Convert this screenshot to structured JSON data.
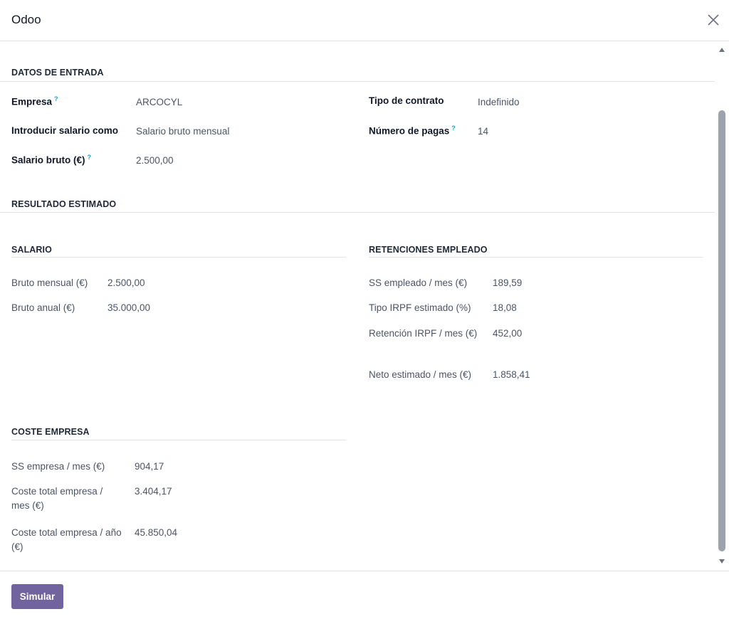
{
  "dialog": {
    "title": "Odoo",
    "close_icon": "close-icon"
  },
  "input_section": {
    "title": "DATOS DE ENTRADA",
    "fields": {
      "empresa": {
        "label": "Empresa",
        "help": "?",
        "value": "ARCOCYL"
      },
      "salario_como": {
        "label": "Introducir salario como",
        "value": "Salario bruto mensual"
      },
      "salario_bruto": {
        "label": "Salario bruto (€)",
        "help": "?",
        "value": "2.500,00"
      },
      "tipo_contrato": {
        "label": "Tipo de contrato",
        "value": "Indefinido"
      },
      "numero_pagas": {
        "label": "Número de pagas",
        "help": "?",
        "value": "14"
      }
    }
  },
  "result_section": {
    "title": "RESULTADO ESTIMADO",
    "salario": {
      "title": "SALARIO",
      "rows": [
        {
          "label": "Bruto mensual (€)",
          "value": "2.500,00"
        },
        {
          "label": "Bruto anual (€)",
          "value": "35.000,00"
        }
      ]
    },
    "retenciones": {
      "title": "RETENCIONES EMPLEADO",
      "rows": [
        {
          "label": "SS empleado / mes (€)",
          "value": "189,59"
        },
        {
          "label": "Tipo IRPF estimado (%)",
          "value": "18,08"
        },
        {
          "label": "Retención IRPF / mes (€)",
          "value": "452,00"
        },
        {
          "label": "Neto estimado / mes (€)",
          "value": "1.858,41"
        }
      ]
    },
    "coste": {
      "title": "COSTE EMPRESA",
      "rows": [
        {
          "label": "SS empresa / mes (€)",
          "value": "904,17"
        },
        {
          "label": "Coste total empresa / mes (€)",
          "value": "3.404,17"
        },
        {
          "label": "Coste total empresa / año (€)",
          "value": "45.850,04"
        }
      ]
    }
  },
  "footer": {
    "simulate_label": "Simular"
  },
  "colors": {
    "primary": "#71639e",
    "help": "#0ea5c6",
    "border": "#dee2e6"
  }
}
